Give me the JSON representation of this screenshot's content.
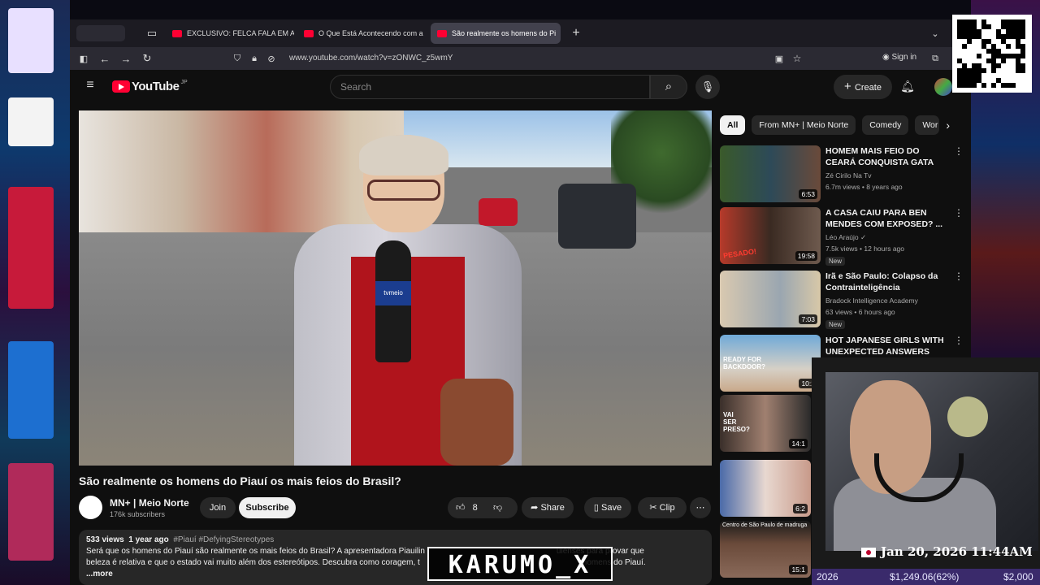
{
  "browser": {
    "tabs": [
      {
        "label": "EXCLUSIVO: FELCA FALA EM AL",
        "active": false
      },
      {
        "label": "O Que Está Acontecendo com a",
        "active": false
      },
      {
        "label": "São realmente os homens do Pi",
        "active": true
      }
    ],
    "url": "www.youtube.com/watch?v=zONWC_z5wmY",
    "sign_in": "Sign in"
  },
  "youtube": {
    "logo": "YouTube",
    "region": "JP",
    "search_placeholder": "Search",
    "create_label": "Create"
  },
  "video": {
    "title": "São realmente os homens do Piauí os mais feios do Brasil?",
    "channel": "MN+ | Meio Norte",
    "subscribers": "176k subscribers",
    "join": "Join",
    "subscribe": "Subscribe",
    "likes": "8",
    "share": "Share",
    "save": "Save",
    "clip": "Clip",
    "mic_brand": "tvmeio",
    "views": "533 views",
    "age": "1 year ago",
    "tags": "#Piauí #DefyingStereotypes",
    "description_line1": "Será que os homens do Piauí são realmente os mais feios do Brasil? A apresentadora Piauilin",
    "description_line1b": "uienses para provar que",
    "description_line2": "beleza é relativa e que o estado vai muito além dos estereótipos. Descubra como coragem, t",
    "description_line2b": "homens do Piauí.",
    "more": "...more"
  },
  "chips": [
    "All",
    "From MN+ | Meio Norte",
    "Comedy",
    "Wor"
  ],
  "recommendations": [
    {
      "title": "HOMEM MAIS FEIO DO CEARÁ CONQUISTA GATA",
      "channel": "Zé Cirilo Na Tv",
      "meta": "6.7m views • 8 years ago",
      "duration": "6:53",
      "badge": ""
    },
    {
      "title": "A CASA CAIU PARA BEN MENDES COM EXPOSED? ...",
      "channel": "Léo Araújo ✓",
      "meta": "7.5k views • 12 hours ago",
      "duration": "19:58",
      "badge": "New"
    },
    {
      "title": "Irã e São Paulo: Colapso da Contrainteligência",
      "channel": "Bradock Intelligence Academy",
      "meta": "63 views • 6 hours ago",
      "duration": "7:03",
      "badge": "New"
    },
    {
      "title": "HOT JAPANESE GIRLS WITH UNEXPECTED ANSWERS",
      "channel": "",
      "meta": "",
      "duration": "10:2",
      "badge": ""
    },
    {
      "title": "",
      "channel": "",
      "meta": "",
      "duration": "14:1",
      "badge": ""
    },
    {
      "title": "",
      "channel": "",
      "meta": "",
      "duration": "6:2",
      "badge": ""
    },
    {
      "title": "",
      "channel": "",
      "meta": "",
      "duration": "15:1",
      "badge": ""
    }
  ],
  "thumb_texts": {
    "t2_left": "PESADO!",
    "t4_top": "READY FOR BACKDOOR?",
    "t5_text": "VAI SER PRESO?",
    "t7_caption": "Centro de São Paulo de madruga"
  },
  "overlay": {
    "datetime": "Jan 20, 2026 11:44AM",
    "ticker_year": "2026",
    "ticker_value": "$1,249.06(62%)",
    "ticker_goal": "$2,000",
    "watermark": "KARUMO_X"
  },
  "colors": {
    "youtube_red": "#ff0033",
    "page_bg": "#0f0f0f",
    "chip_bg": "#272727"
  }
}
